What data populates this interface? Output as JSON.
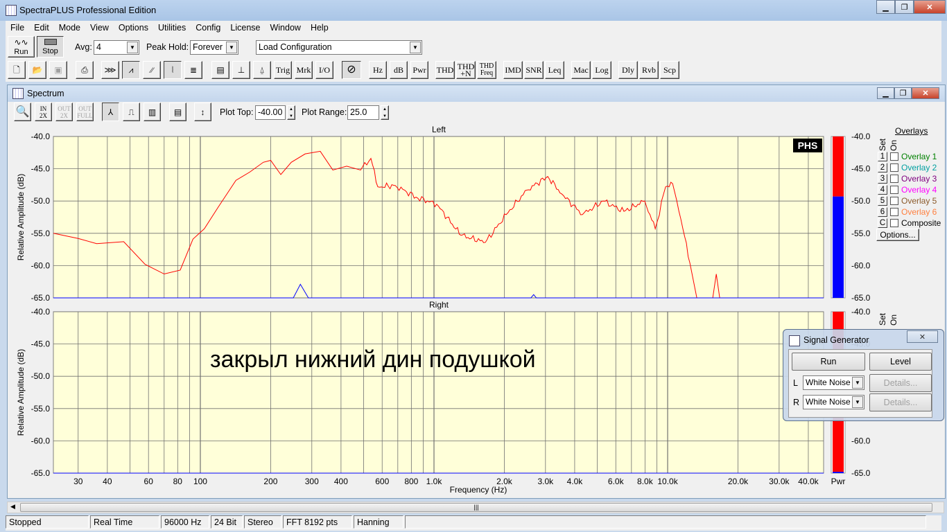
{
  "app": {
    "title": "SpectraPLUS Professional Edition"
  },
  "menu": [
    "File",
    "Edit",
    "Mode",
    "View",
    "Options",
    "Utilities",
    "Config",
    "License",
    "Window",
    "Help"
  ],
  "toolbar1": {
    "run": "Run",
    "stop": "Stop",
    "avg_label": "Avg:",
    "avg_value": "4",
    "peak_label": "Peak Hold:",
    "peak_value": "Forever",
    "config_value": "Load Configuration"
  },
  "toolbar2": {
    "buttons": [
      "Trig",
      "Mrk",
      "I/O",
      "Hz",
      "dB",
      "Pwr",
      "THD",
      "THD +N",
      "THD Freq",
      "IMD",
      "SNR",
      "Leq",
      "Mac",
      "Log",
      "Dly",
      "Rvb",
      "Scp"
    ]
  },
  "spectrum": {
    "title": "Spectrum",
    "plot_top_label": "Plot Top:",
    "plot_top_value": "-40.00",
    "plot_range_label": "Plot Range:",
    "plot_range_value": "25.0",
    "logo": "PHS",
    "annotation": "закрыл нижний дин подушкой",
    "meter_label": "Pwr",
    "overlays": {
      "title": "Overlays",
      "set_label": "Set",
      "on_label": "On",
      "options": "Options...",
      "items": [
        {
          "set": "1",
          "label": "Overlay 1",
          "color": "#008000"
        },
        {
          "set": "2",
          "label": "Overlay 2",
          "color": "#00a0a0"
        },
        {
          "set": "3",
          "label": "Overlay 3",
          "color": "#800080"
        },
        {
          "set": "4",
          "label": "Overlay 4",
          "color": "#ff00ff"
        },
        {
          "set": "5",
          "label": "Overlay 5",
          "color": "#8b5a2b"
        },
        {
          "set": "6",
          "label": "Overlay 6",
          "color": "#ff8040"
        },
        {
          "set": "C",
          "label": "Composite",
          "color": "#000000"
        }
      ]
    }
  },
  "chart_data": [
    {
      "type": "line",
      "title": "Left",
      "xlabel": "Frequency (Hz)",
      "ylabel": "Relative Amplitude (dB)",
      "xscale": "log",
      "xlim": [
        23.5,
        46500
      ],
      "ylim": [
        -65,
        -40
      ],
      "grid": true,
      "yticks": [
        "-40.0",
        "-45.0",
        "-50.0",
        "-55.0",
        "-60.0",
        "-65.0"
      ],
      "xticks": [
        {
          "v": 30,
          "l": "30"
        },
        {
          "v": 40,
          "l": "40"
        },
        {
          "v": 60,
          "l": "60"
        },
        {
          "v": 80,
          "l": "80"
        },
        {
          "v": 100,
          "l": "100"
        },
        {
          "v": 200,
          "l": "200"
        },
        {
          "v": 300,
          "l": "300"
        },
        {
          "v": 400,
          "l": "400"
        },
        {
          "v": 600,
          "l": "600"
        },
        {
          "v": 800,
          "l": "800"
        },
        {
          "v": 1000,
          "l": "1.0k"
        },
        {
          "v": 2000,
          "l": "2.0k"
        },
        {
          "v": 3000,
          "l": "3.0k"
        },
        {
          "v": 4000,
          "l": "4.0k"
        },
        {
          "v": 6000,
          "l": "6.0k"
        },
        {
          "v": 8000,
          "l": "8.0k"
        },
        {
          "v": 10000,
          "l": "10.0k"
        },
        {
          "v": 20000,
          "l": "20.0k"
        },
        {
          "v": 30000,
          "l": "30.0k"
        },
        {
          "v": 40000,
          "l": "40.0k"
        }
      ],
      "series": [
        {
          "color": "#ff0000",
          "x": [
            23.5,
            30,
            36,
            47,
            58,
            70,
            82,
            93,
            104,
            119,
            142,
            163,
            186,
            200,
            221,
            245,
            281,
            326,
            369,
            423,
            485,
            537,
            575,
            683,
            838,
            1027,
            1305,
            1660,
            2037,
            2500,
            3070,
            3520,
            4320,
            5300,
            6500,
            7980,
            8850,
            9800,
            10500,
            11620,
            12450,
            13330,
            14760,
            15600,
            16150,
            16700,
            46500
          ],
          "y": [
            -55,
            -55.8,
            -56.6,
            -56.3,
            -59.8,
            -61.3,
            -60.7,
            -55.9,
            -54.3,
            -51,
            -46.8,
            -45.5,
            -44,
            -43.7,
            -45.9,
            -44,
            -42.7,
            -42.3,
            -45.2,
            -44.6,
            -45.2,
            -43.4,
            -47.8,
            -47.6,
            -49.4,
            -50.5,
            -55.3,
            -56.4,
            -52.1,
            -48.3,
            -46.2,
            -48.9,
            -52.1,
            -50,
            -51.6,
            -50,
            -54.3,
            -47.8,
            -47.3,
            -54.3,
            -59.6,
            -65,
            -65,
            -65,
            -61.3,
            -65,
            -65
          ]
        },
        {
          "color": "#0000ff",
          "x": [
            23.5,
            250,
            268,
            290,
            2600,
            2670,
            2740,
            46500
          ],
          "y": [
            -65,
            -65,
            -62.9,
            -65,
            -65,
            -64.5,
            -65,
            -65
          ]
        }
      ],
      "meter": {
        "red_top": -40,
        "blue_top": -49.3
      }
    },
    {
      "type": "line",
      "title": "Right",
      "xlabel": "Frequency (Hz)",
      "ylabel": "Relative Amplitude (dB)",
      "xscale": "log",
      "xlim": [
        23.5,
        46500
      ],
      "ylim": [
        -65,
        -40
      ],
      "grid": true,
      "yticks": [
        "-40.0",
        "-45.0",
        "-50.0",
        "-55.0",
        "-60.0",
        "-65.0"
      ],
      "series": [
        {
          "color": "#0000ff",
          "x": [
            23.5,
            46500
          ],
          "y": [
            -65,
            -65
          ]
        }
      ],
      "meter": {
        "red_top": -40,
        "blue_top": -64.8
      }
    }
  ],
  "signal_generator": {
    "title": "Signal Generator",
    "run": "Run",
    "level": "Level",
    "l_label": "L",
    "r_label": "R",
    "l_value": "White Noise",
    "r_value": "White Noise",
    "details": "Details..."
  },
  "status": [
    "Stopped",
    "Real Time",
    "96000 Hz",
    "24 Bit",
    "Stereo",
    "FFT 8192 pts",
    "Hanning",
    ""
  ]
}
